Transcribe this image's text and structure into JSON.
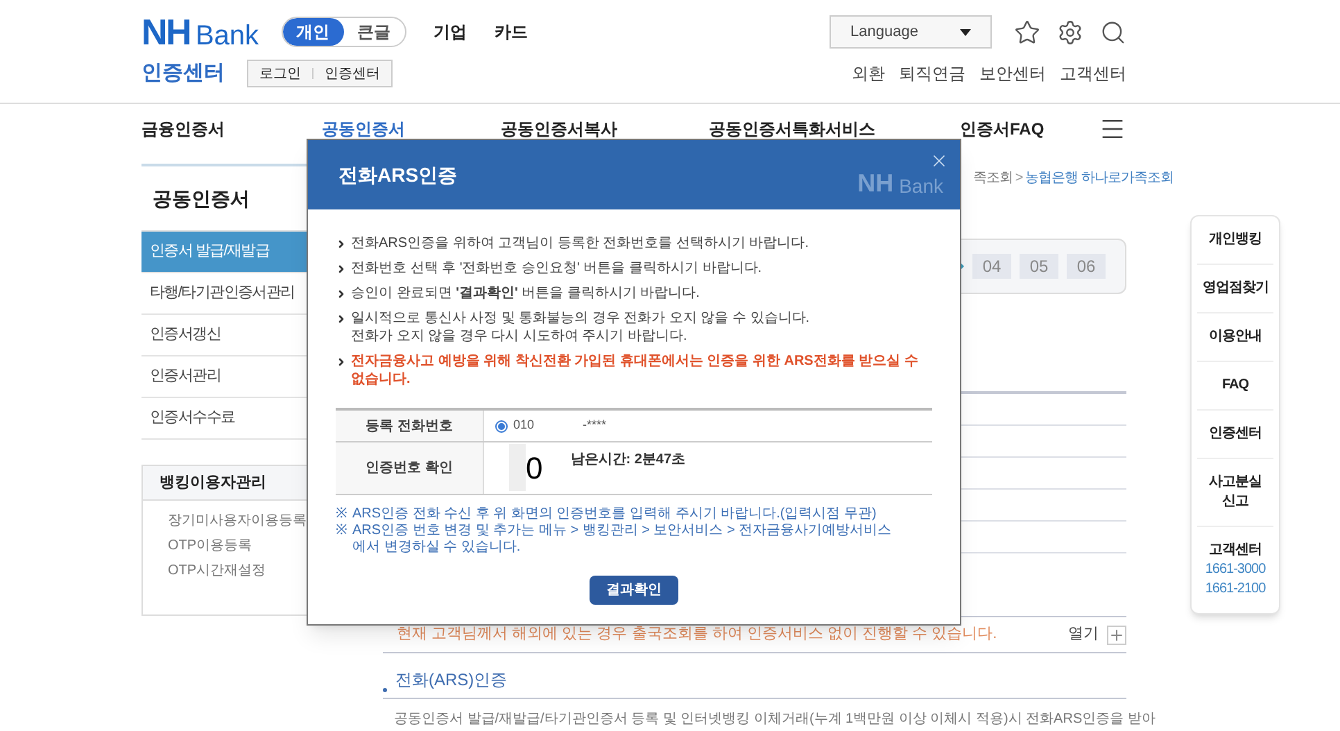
{
  "header": {
    "logo": {
      "mark": "NH",
      "text": "Bank"
    },
    "mode_tabs": [
      {
        "label": "개인",
        "selected": true
      },
      {
        "label": "큰글",
        "selected": false
      }
    ],
    "top_links": [
      "기업",
      "카드"
    ],
    "language": {
      "value": "Language"
    },
    "section_title": "인증센터",
    "sub_links": [
      "로그인",
      "인증센터"
    ],
    "utility_links": [
      "외환",
      "퇴직연금",
      "보안센터",
      "고객센터"
    ]
  },
  "nav": [
    {
      "label": "금융인증서",
      "selected": false
    },
    {
      "label": "공동인증서",
      "selected": true
    },
    {
      "label": "공동인증서복사",
      "selected": false
    },
    {
      "label": "공동인증서특화서비스",
      "selected": false
    },
    {
      "label": "인증서FAQ",
      "selected": false
    }
  ],
  "sidebar": {
    "title": "공동인증서",
    "items": [
      {
        "label": "인증서 발급/재발급",
        "selected": true
      },
      {
        "label": "타행/타기관인증서관리",
        "selected": false
      },
      {
        "label": "인증서갱신",
        "selected": false
      },
      {
        "label": "인증서관리",
        "selected": false
      },
      {
        "label": "인증서수수료",
        "selected": false
      }
    ],
    "sub_box": {
      "title": "뱅킹이용자관리",
      "items": [
        "장기미사용자이용등록",
        "OTP이용등록",
        "OTP시간재설정"
      ]
    }
  },
  "breadcrumb": [
    {
      "label": "족조회",
      "selected": false
    },
    {
      "label": "농협은행 하나로가족조회",
      "selected": true
    }
  ],
  "breadcrumb_separator": ">",
  "steps": [
    {
      "label": "04"
    },
    {
      "label": "05"
    },
    {
      "label": "06"
    }
  ],
  "notice": {
    "text": "현재 고객님께서 해외에 있는 경우 출국조회를 하여 인증서비스 없이 진행할 수 있습니다.",
    "toggle_label": "열기"
  },
  "section": {
    "heading": "전화(ARS)인증",
    "paragraph": "공동인증서 발급/재발급/타기관인증서 등록 및 인터넷뱅킹 이체거래(누계 1백만원 이상 이체시 적용)시 전화ARS인증을 받아"
  },
  "quick_menu": [
    {
      "label": "개인뱅킹"
    },
    {
      "label": "영업점찾기"
    },
    {
      "label": "이용안내"
    },
    {
      "label": "FAQ"
    },
    {
      "label": "인증센터"
    },
    {
      "label": "사고분실\n신고"
    },
    {
      "label": "고객센터",
      "phones": [
        "1661-3000",
        "1661-2100"
      ]
    }
  ],
  "modal": {
    "title": "전화ARS인증",
    "logo": {
      "mark": "NH",
      "text": "Bank"
    },
    "instructions": [
      {
        "kind": "normal",
        "text": "전화ARS인증을 위하여 고객님이 등록한 전화번호를 선택하시기 바랍니다."
      },
      {
        "kind": "normal",
        "text": "전화번호 선택 후 '전화번호 승인요청' 버튼을 클릭하시기 바랍니다."
      },
      {
        "kind": "normal",
        "text": "승인이 완료되면 **'결과확인'** 버튼을 클릭하시기 바랍니다."
      },
      {
        "kind": "normal",
        "text": "일시적으로 통신사 사정 및 통화불능의 경우 전화가 오지 않을 수 있습니다.\n전화가 오지 않을 경우 다시 시도하여 주시기 바랍니다."
      },
      {
        "kind": "warning",
        "text": "전자금융사고 예방을 위해 착신전환 가입된 휴대폰에서는 인증을 위한 ARS전화를 받으실 수 없습니다."
      }
    ],
    "rows": [
      {
        "kind": "radio",
        "label": "등록 전화번호",
        "selected": true,
        "value_start": "010",
        "value_end": "-****"
      },
      {
        "kind": "code",
        "label": "인증번호 확인",
        "value": "0",
        "timer": "남은시간: 2분47초"
      }
    ],
    "notes": [
      {
        "mark": "※",
        "text": "ARS인증 전화 수신 후 위 화면의 인증번호를 입력해 주시기 바랍니다.(입력시점 무관)"
      },
      {
        "mark": "※",
        "text": "ARS인증 번호 변경 및 추가는 메뉴 > 뱅킹관리 > 보안서비스 > 전자금융사기예방서비스\n에서 변경하실 수 있습니다."
      }
    ],
    "button": "결과확인"
  }
}
